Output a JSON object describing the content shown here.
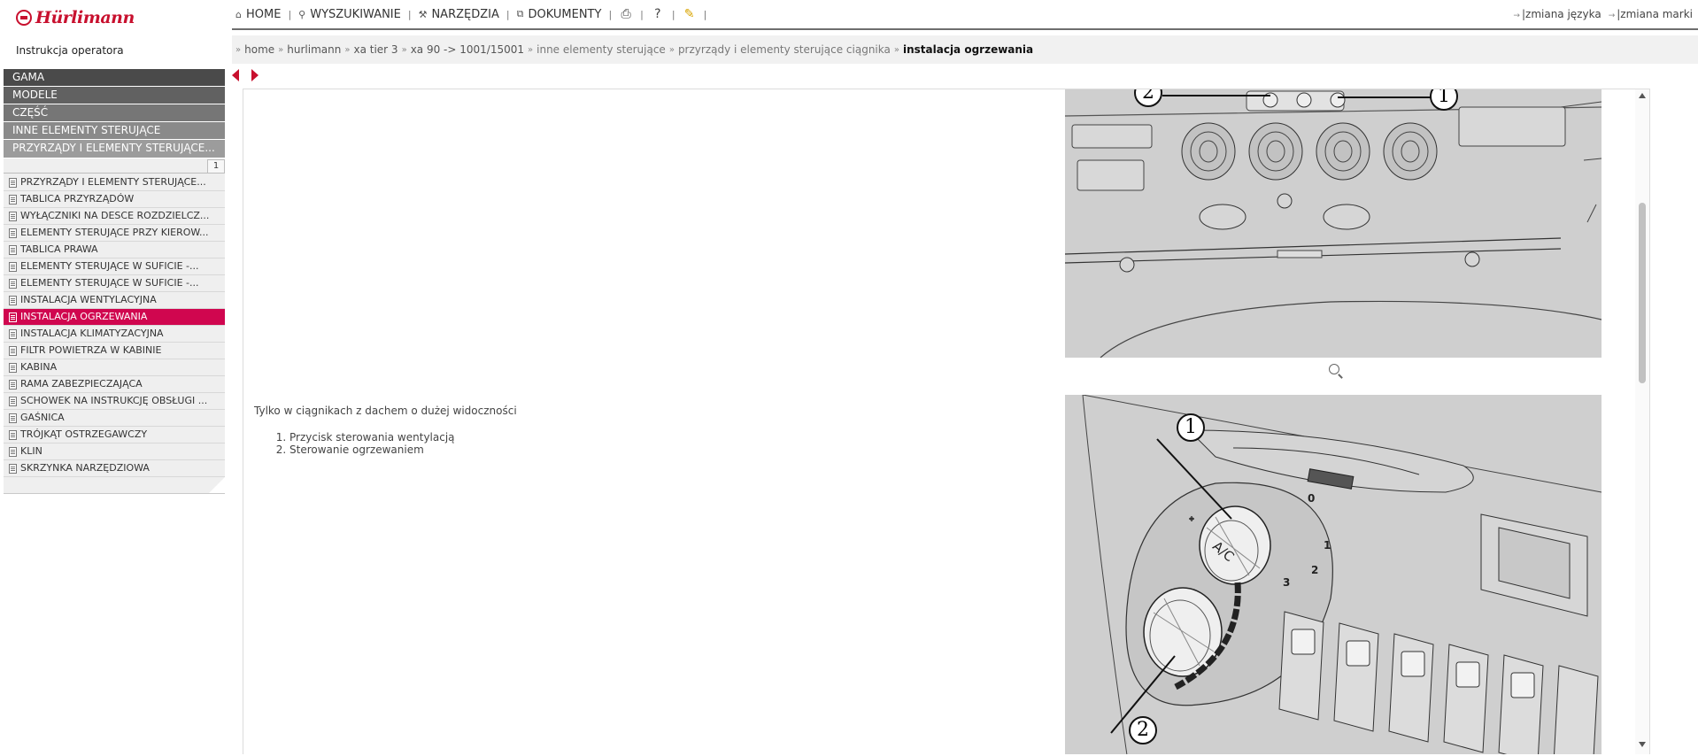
{
  "logo": {
    "text": "Hürlimann"
  },
  "nav": {
    "home": "HOME",
    "search": "WYSZUKIWANIE",
    "tools": "NARZĘDZIA",
    "documents": "DOKUMENTY"
  },
  "topright": {
    "change_language": "zmiana języka",
    "change_brand": "zmiana marki"
  },
  "doc_title": "Instrukcja operatora",
  "breadcrumb": [
    "home",
    "hurlimann",
    "xa tier 3",
    "xa 90 -> 1001/15001",
    "inne elementy sterujące",
    "przyrządy i elementy sterujące ciągnika",
    "instalacja ogrzewania"
  ],
  "sidebar": {
    "categories": [
      "GAMA",
      "MODELE",
      "CZĘŚĆ",
      "INNE ELEMENTY STERUJĄCE",
      "PRZYRZĄDY I ELEMENTY STERUJĄCE..."
    ],
    "page": "1",
    "items": [
      "PRZYRZĄDY I ELEMENTY STERUJĄCE...",
      "TABLICA PRZYRZĄDÓW",
      "WYŁĄCZNIKI NA DESCE ROZDZIELCZ...",
      "ELEMENTY STERUJĄCE PRZY KIEROW...",
      "TABLICA PRAWA",
      "ELEMENTY STERUJĄCE W SUFICIE -...",
      "ELEMENTY STERUJĄCE W SUFICIE -...",
      "INSTALACJA WENTYLACYJNA",
      "INSTALACJA OGRZEWANIA",
      "INSTALACJA KLIMATYZACYJNA",
      "FILTR POWIETRZA W KABINIE",
      "KABINA",
      "RAMA ZABEZPIECZAJĄCA",
      "SCHOWEK NA INSTRUKCJĘ OBSŁUGI ...",
      "GAŚNICA",
      "TRÓJKĄT OSTRZEGAWCZY",
      "KLIN",
      "SKRZYNKA NARZĘDZIOWA"
    ],
    "active_index": 8
  },
  "content": {
    "intro": "Tylko w ciągnikach z dachem o dużej widoczności",
    "list": [
      "Przycisk sterowania wentylacją",
      "Sterowanie ogrzewaniem"
    ],
    "fig1_callouts": [
      "2",
      "1"
    ],
    "fig2_callouts": [
      "1",
      "2"
    ],
    "fig2_knob_label": "A/C",
    "fig2_scale": [
      "0",
      "1",
      "2",
      "3"
    ]
  },
  "colors": {
    "brand": "#c8102e",
    "active": "#d0064f"
  }
}
